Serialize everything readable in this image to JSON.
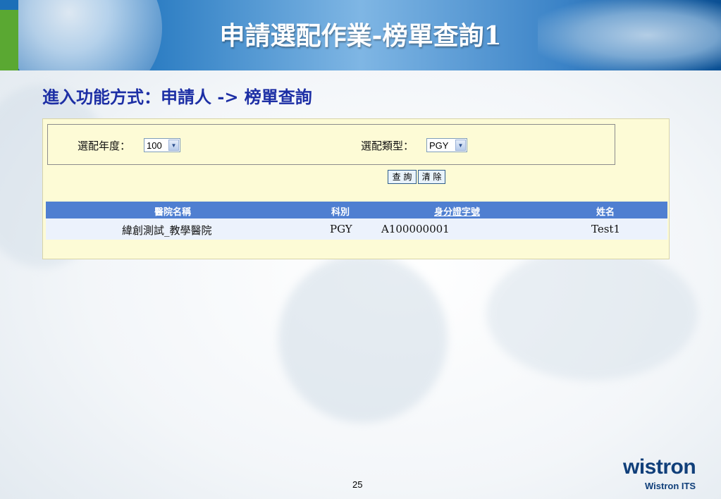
{
  "slide": {
    "title": "申請選配作業-榜單查詢1",
    "subtitle": "進入功能方式：申請人 -> 榜單查詢",
    "page_number": "25"
  },
  "filters": {
    "year_label": "選配年度：",
    "year_value": "100",
    "type_label": "選配類型：",
    "type_value": "PGY"
  },
  "buttons": {
    "query": "查 詢",
    "clear": "清 除"
  },
  "table": {
    "headers": [
      "醫院名稱",
      "科別",
      "身分證字號",
      "姓名"
    ],
    "rows": [
      [
        "緯創測試_教學醫院",
        "PGY",
        "A100000001",
        "Test1"
      ]
    ]
  },
  "brand": {
    "logo": "wistron",
    "sub": "Wistron ITS"
  },
  "colors": {
    "banner": "#1f6cb5",
    "subtitle": "#1d2fa5",
    "panel_bg": "#fdfbd6",
    "grid_header": "#4f7fd1"
  }
}
